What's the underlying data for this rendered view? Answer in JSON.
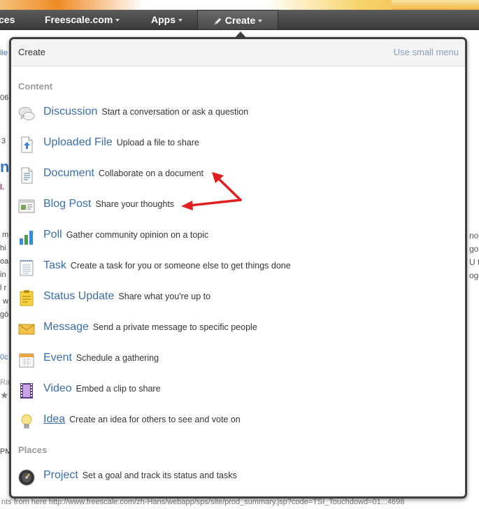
{
  "nav": {
    "spaces_label": "ces",
    "freescale_label": "Freescale.com",
    "apps_label": "Apps",
    "create_label": "Create"
  },
  "background": {
    "left_fragments": [
      "lle",
      "06",
      "3",
      "ne",
      "l.",
      "m",
      "hi",
      "oa",
      "in",
      "l r",
      "w",
      "gó",
      "0c",
      "Ra",
      "PM"
    ],
    "right_fragments": [
      "no",
      "goi",
      "U t",
      "ogr"
    ],
    "status_url": "nts from here http://www.freescale.com/zh-Hans/webapp/sps/site/prod_summary.jsp?code=TSI_Touchdowd=01...4698"
  },
  "popup": {
    "title": "Create",
    "small_menu_link": "Use small menu",
    "section_content": "Content",
    "section_places": "Places",
    "items": [
      {
        "label": "Discussion",
        "desc": "Start a conversation or ask a question",
        "icon": "discussion-icon"
      },
      {
        "label": "Uploaded File",
        "desc": "Upload a file to share",
        "icon": "upload-file-icon"
      },
      {
        "label": "Document",
        "desc": "Collaborate on a document",
        "icon": "document-icon"
      },
      {
        "label": "Blog Post",
        "desc": "Share your thoughts",
        "icon": "blog-post-icon"
      },
      {
        "label": "Poll",
        "desc": "Gather community opinion on a topic",
        "icon": "poll-icon"
      },
      {
        "label": "Task",
        "desc": "Create a task for you or someone else to get things done",
        "icon": "task-icon"
      },
      {
        "label": "Status Update",
        "desc": "Share what you're up to",
        "icon": "status-update-icon"
      },
      {
        "label": "Message",
        "desc": "Send a private message to specific people",
        "icon": "message-icon"
      },
      {
        "label": "Event",
        "desc": "Schedule a gathering",
        "icon": "event-icon"
      },
      {
        "label": "Video",
        "desc": "Embed a clip to share",
        "icon": "video-icon"
      },
      {
        "label": "Idea",
        "desc": "Create an idea for others to see and vote on",
        "icon": "idea-icon"
      }
    ],
    "places": [
      {
        "label": "Project",
        "desc": "Set a goal and track its status and tasks",
        "icon": "project-icon"
      }
    ]
  },
  "colors": {
    "link": "#3a6ea8",
    "arrow": "#e02020",
    "navbar": "#4a4a4a"
  }
}
